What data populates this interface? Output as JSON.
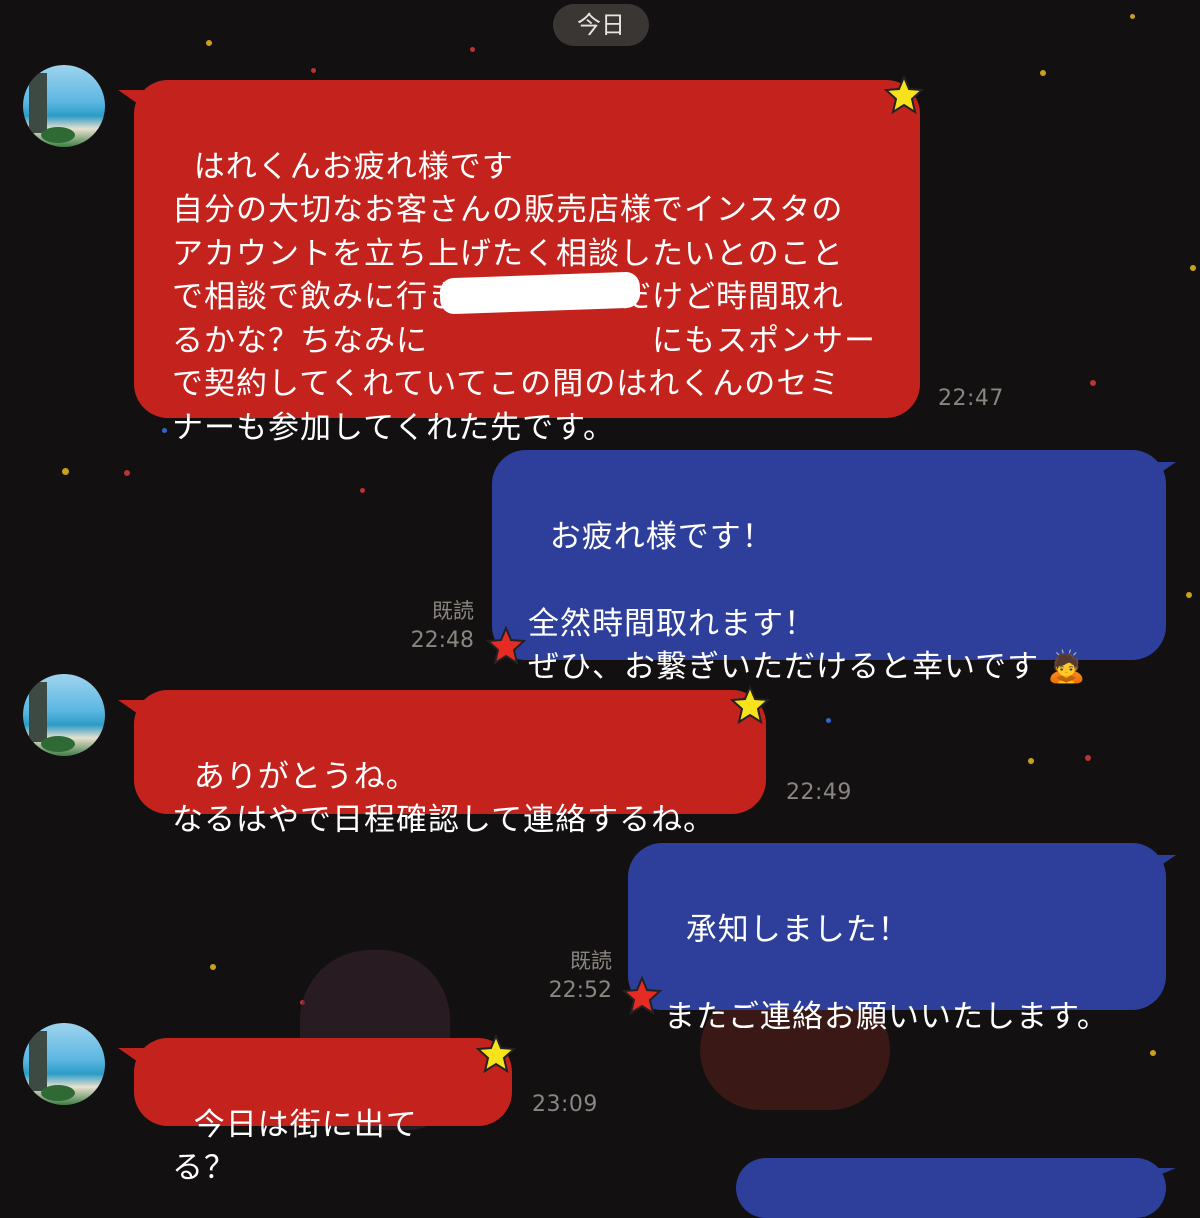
{
  "date_divider": "今日",
  "colors": {
    "background": "#121010",
    "incoming_bubble": "#c4231d",
    "outgoing_bubble": "#2e3f9b",
    "meta_text": "#8b8580"
  },
  "messages": [
    {
      "direction": "incoming",
      "text": "はれくんお疲れ様です\n自分の大切なお客さんの販売店様でインスタの\nアカウントを立ち上げたく相談したいとのこと\nで相談で飲みに行きたいらしんだけど時間取れ\nるかな？ちなみに　　　　　　　にもスポンサー\nで契約してくれていてこの間のはれくんのセミ\nナーも参加してくれた先です。",
      "time": "22:47"
    },
    {
      "direction": "outgoing",
      "text": "お疲れ様です！\n\n全然時間取れます！\nぜひ、お繋ぎいただけると幸いです",
      "emoji": "🙇",
      "read": "既読",
      "time": "22:48"
    },
    {
      "direction": "incoming",
      "text": "ありがとうね。\nなるはやで日程確認して連絡するね。",
      "time": "22:49"
    },
    {
      "direction": "outgoing",
      "text": "承知しました！\n\nまたご連絡お願いいたします。",
      "read": "既読",
      "time": "22:52"
    },
    {
      "direction": "incoming",
      "text": "今日は街に出てる？",
      "time": "23:09"
    }
  ],
  "icons": {
    "avatar": "avatar-beach-photo",
    "star": "star-sticker-icon"
  }
}
